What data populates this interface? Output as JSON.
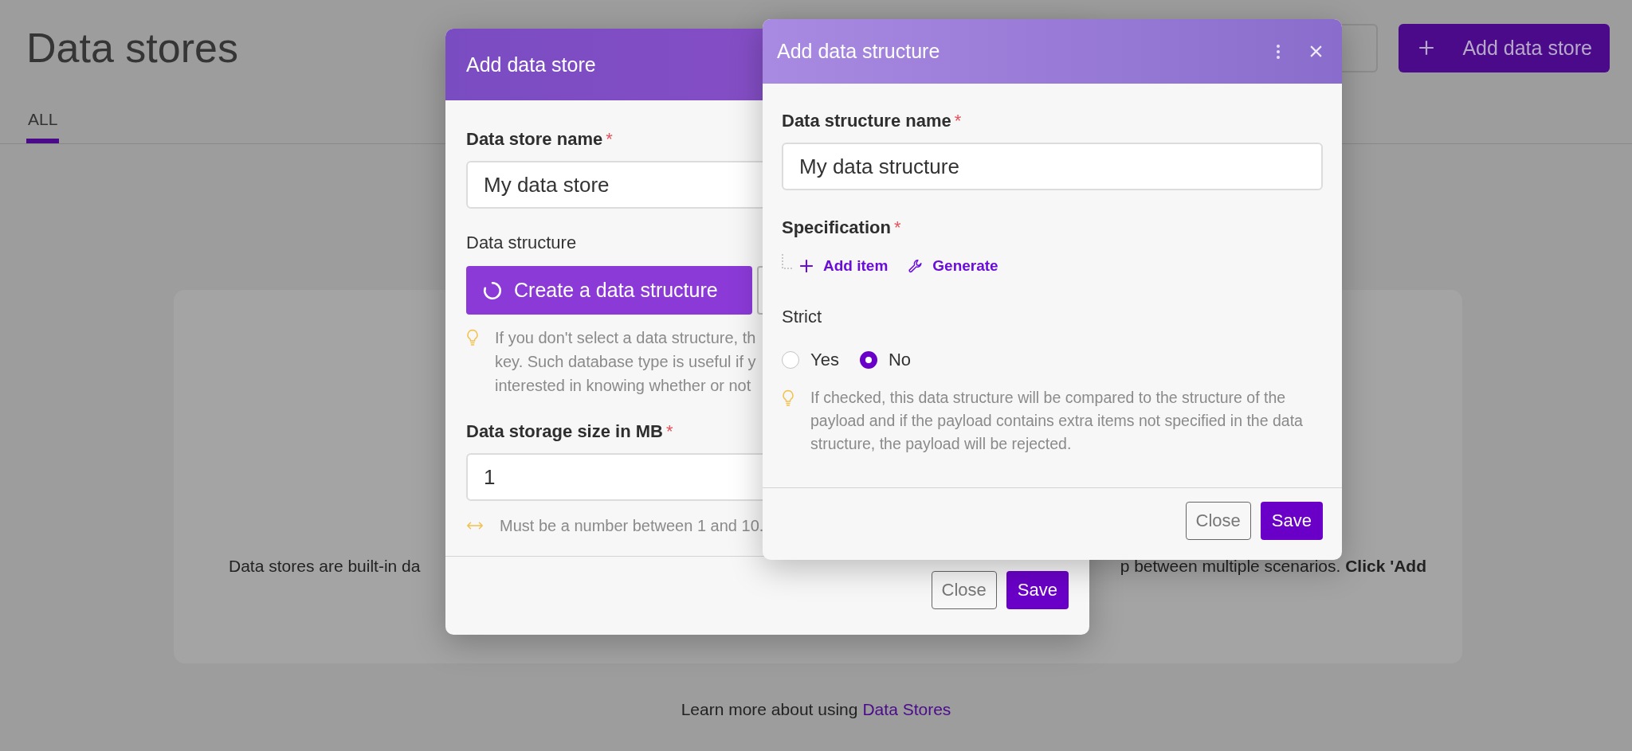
{
  "page": {
    "title": "Data stores",
    "tabs": [
      {
        "label": "ALL",
        "selected": true
      }
    ],
    "add_button": "Add data store",
    "empty_state": {
      "text_left": "Data stores are built-in da",
      "text_right": "p between multiple scenarios. **Click 'Add**"
    },
    "learn_more": {
      "text": "Learn more about using",
      "link": "Data Stores"
    }
  },
  "dialog_store": {
    "title": "Add data store",
    "name_field": {
      "label": "Data store name",
      "marker": "*",
      "value": "My data store"
    },
    "structure_label": "Data structure",
    "create_button": "Create a data structure",
    "structure_hint": [
      "If you don't select a data structure, th",
      "key. Such database type is useful if y",
      "interested in knowing whether or not"
    ],
    "size_field": {
      "label": "Data storage size in MB",
      "marker": "*",
      "value": "1",
      "hint": "Must be a number between 1 and 10."
    },
    "buttons": [
      "Close",
      "Save"
    ]
  },
  "dialog_structure": {
    "title": "Add data structure",
    "name_field": {
      "label": "Data structure name",
      "marker": "*",
      "value": "My data structure"
    },
    "specification": {
      "label": "Specification",
      "marker": "*",
      "actions": [
        {
          "kind": "add",
          "label": "Add item"
        },
        {
          "kind": "generate",
          "label": "Generate"
        }
      ]
    },
    "strict": {
      "label": "Strict",
      "options": [
        {
          "label": "Yes",
          "selected": false
        },
        {
          "label": "No",
          "selected": true
        }
      ],
      "hint": "If checked, this data structure will be compared to the structure of the payload and if the payload contains extra items not specified in the data structure, the payload will be rejected."
    },
    "buttons": [
      "Close",
      "Save"
    ]
  }
}
